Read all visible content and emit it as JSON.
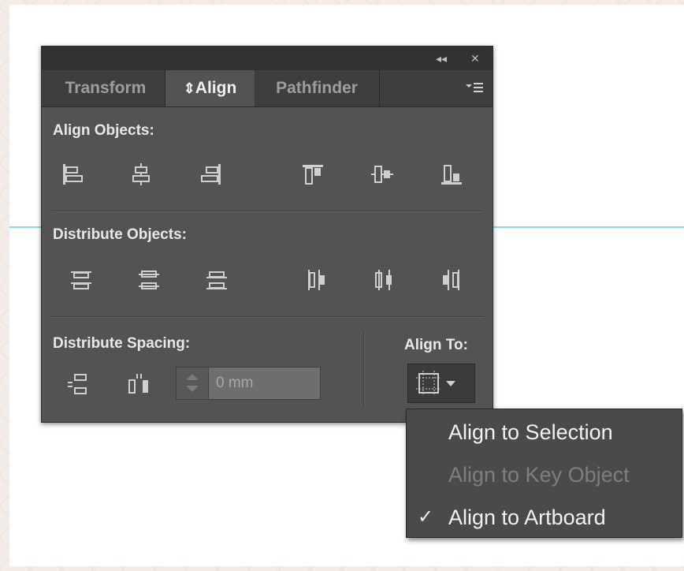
{
  "panel": {
    "title_controls": {
      "collapse": "◂◂",
      "close": "✕"
    },
    "tabs": [
      {
        "label": "Transform",
        "active": false
      },
      {
        "label": "Align",
        "prefix": "⇕",
        "active": true
      },
      {
        "label": "Pathfinder",
        "active": false
      }
    ],
    "panel_menu_icon": "panel-menu-icon",
    "sections": {
      "align_objects": {
        "label": "Align Objects:",
        "buttons": [
          "horizontal-align-left-icon",
          "horizontal-align-center-icon",
          "horizontal-align-right-icon",
          "vertical-align-top-icon",
          "vertical-align-center-icon",
          "vertical-align-bottom-icon"
        ]
      },
      "distribute_objects": {
        "label": "Distribute Objects:",
        "buttons": [
          "vertical-distribute-top-icon",
          "vertical-distribute-center-icon",
          "vertical-distribute-bottom-icon",
          "horizontal-distribute-left-icon",
          "horizontal-distribute-center-icon",
          "horizontal-distribute-right-icon"
        ]
      },
      "distribute_spacing": {
        "label": "Distribute Spacing:",
        "buttons": [
          "vertical-distribute-space-icon",
          "horizontal-distribute-space-icon"
        ],
        "spacing_value": "0 mm"
      },
      "align_to": {
        "label": "Align To:",
        "button_icon": "align-to-artboard-icon"
      }
    }
  },
  "dropdown": {
    "items": [
      {
        "label": "Align to Selection",
        "checked": false,
        "disabled": false
      },
      {
        "label": "Align to Key Object",
        "checked": false,
        "disabled": true
      },
      {
        "label": "Align to Artboard",
        "checked": true,
        "disabled": false
      }
    ],
    "check_glyph": "✓"
  },
  "colors": {
    "panel_bg": "#535353",
    "title_bar": "#323232",
    "tab_bar": "#3e3e3e",
    "guide": "#7fe0e0",
    "artboard": "#ffffff",
    "pasteboard": "#f4ece6"
  }
}
